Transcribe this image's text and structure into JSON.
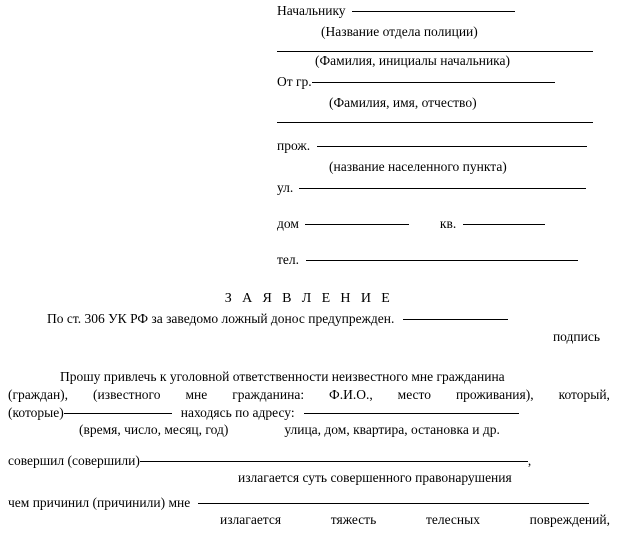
{
  "document": {
    "title": "З А Я В Л Е Н И Е",
    "header": {
      "addressee_label": "Начальнику",
      "department_caption": "(Название отдела полиции)",
      "chief_name_caption": "(Фамилия, инициалы начальника)",
      "from_label": "От  гр.",
      "applicant_name_caption": "(Фамилия, имя, отчество)",
      "residence_label": "прож.",
      "locality_caption": "(название населенного пункта)",
      "street_label": "ул.",
      "house_label": "дом",
      "apartment_label": "кв.",
      "phone_label": "тел."
    },
    "warning": {
      "text": "По ст. 306 УК РФ за заведомо ложный донос предупрежден.",
      "signature_caption": "подпись"
    },
    "body": {
      "line1": "Прошу привлечь к уголовной ответственности неизвестного мне гражданина",
      "line2_parts": [
        "(граждан),",
        "(известного",
        "мне",
        "гражданина:",
        "Ф.И.О.,",
        "место",
        "проживания),",
        "который,"
      ],
      "line3_prefix": "(которые)",
      "line3_middle": "находясь по адресу:",
      "line3_caption_left": "(время, число, месяц, год)",
      "line3_caption_right": "улица, дом, квартира, остановка и др.",
      "line4_prefix": "совершил (совершили)",
      "line4_suffix": ",",
      "line4_caption": "излагается суть совершенного правонарушения",
      "line5_prefix": "чем причинил (причинили) мне",
      "line5_caption_parts": [
        "излагается",
        "тяжесть",
        "телесных",
        "повреждений,"
      ]
    }
  },
  "colors": {
    "ink": "#000000",
    "page": "#ffffff"
  }
}
